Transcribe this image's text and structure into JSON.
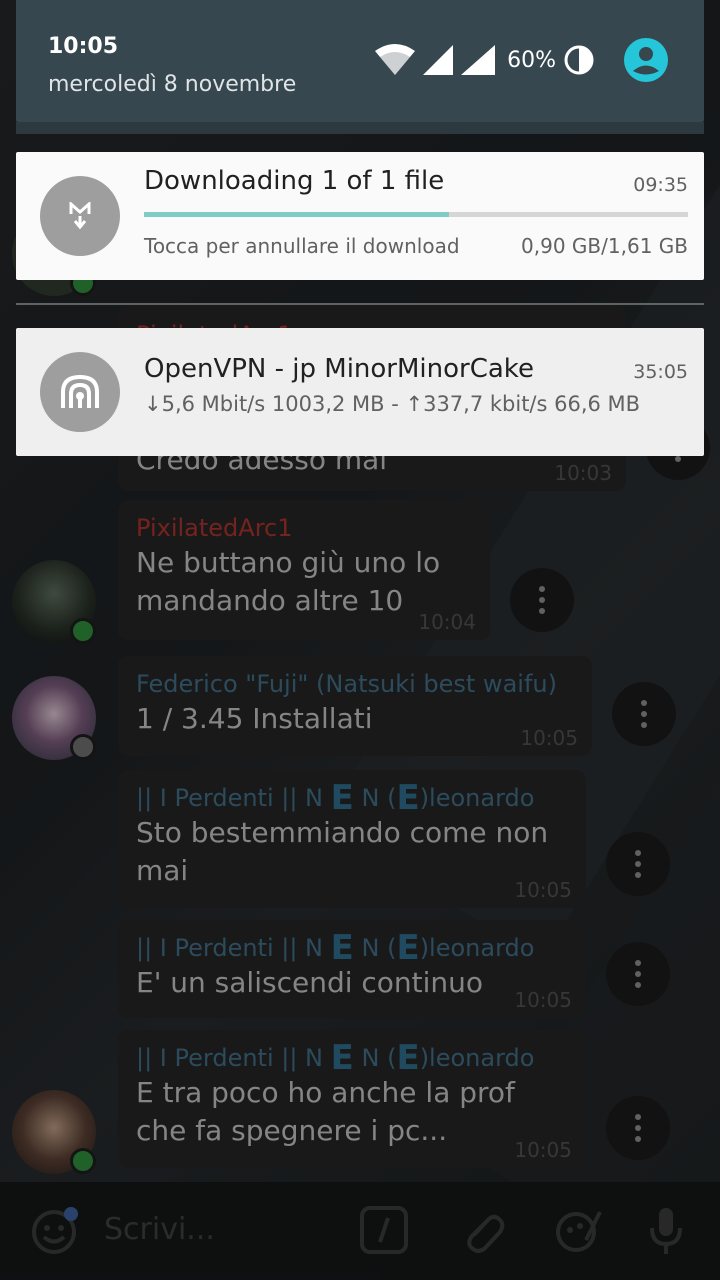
{
  "status_bar": {
    "time": "10:05",
    "date": "mercoledì 8 novembre",
    "battery": "60%",
    "icons": [
      "wifi-icon",
      "signal-icon",
      "signal-icon",
      "battery-icon",
      "account-icon"
    ]
  },
  "notifications": [
    {
      "app": "download",
      "title": "Downloading 1 of 1 file",
      "time": "09:35",
      "subtitle": "Tocca per annullare il download",
      "size": "0,90 GB/1,61 GB",
      "progress": 0.56,
      "icon": "download-icon"
    },
    {
      "app": "vpn",
      "title": "OpenVPN - jp MinorMinorCake",
      "time": "35:05",
      "subtitle": "↓5,6 Mbit/s 1003,2 MB - ↑337,7 kbit/s 66,6 MB",
      "icon": "vpn-lock-icon"
    }
  ],
  "chat": {
    "partial_messages": [
      {
        "sender": "PixilatedArc1",
        "text": "Credo adesso mai",
        "time": "10:03"
      }
    ],
    "messages": [
      {
        "sender": "PixilatedArc1",
        "text_line1": "Ne buttano giù uno lo",
        "text_line2": "mandando altre 10",
        "time": "10:04"
      },
      {
        "sender": "Federico \"Fuji\" (Natsuki best waifu)",
        "text_line1": "1 / 3.45 Installati",
        "time": "10:05"
      },
      {
        "sender_prefix": "|| I Perdenti || N ",
        "sender_e1": "E",
        "sender_mid": " N (",
        "sender_e2": "E",
        "sender_suffix": ")leonardo",
        "text_line1": "Sto bestemmiando come non",
        "text_line2": "mai",
        "time": "10:05"
      },
      {
        "sender_prefix": "|| I Perdenti || N ",
        "sender_e1": "E",
        "sender_mid": " N (",
        "sender_e2": "E",
        "sender_suffix": ")leonardo",
        "text_line1": "E' un saliscendi continuo",
        "time": "10:05"
      },
      {
        "sender_prefix": "|| I Perdenti || N ",
        "sender_e1": "E",
        "sender_mid": " N (",
        "sender_e2": "E",
        "sender_suffix": ")leonardo",
        "text_line1": "E tra poco ho anche la prof",
        "text_line2": "che fa spegnere i pc...",
        "time": "10:05"
      }
    ]
  },
  "input": {
    "placeholder": "Scrivi..."
  },
  "colors": {
    "shade": "#37474f",
    "progress": "#80cbc4",
    "sender_red": "#a8332b",
    "sender_blue": "#3f6c86"
  }
}
